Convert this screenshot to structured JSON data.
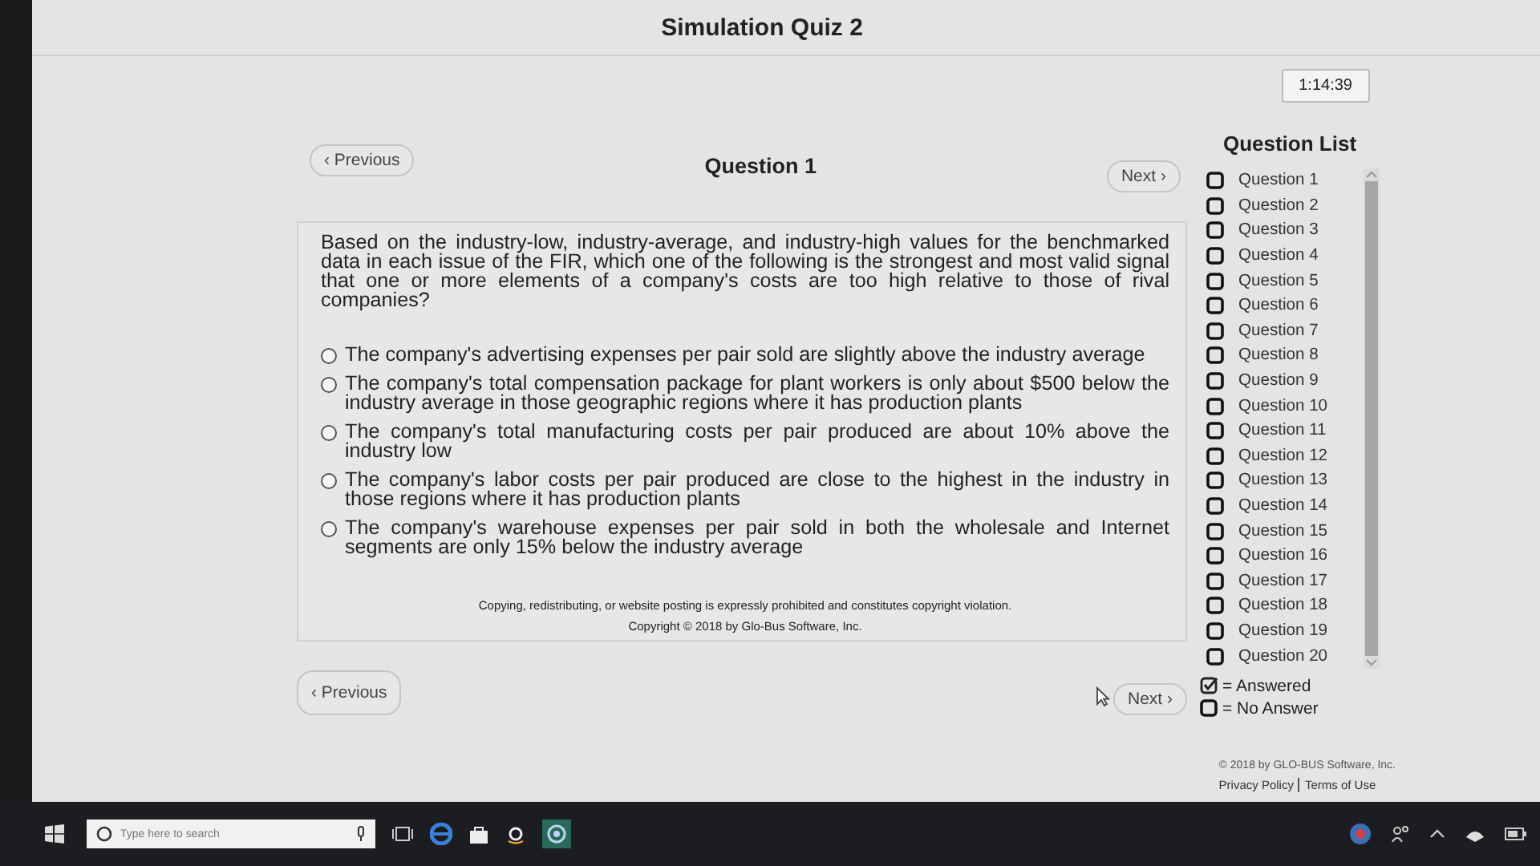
{
  "title": "Simulation Quiz 2",
  "timer": "1:14:39",
  "question": {
    "previous": "‹ Previous",
    "heading": "Question 1",
    "next": "Next ›",
    "text": "Based on the industry-low, industry-average, and industry-high values for the benchmarked data in each issue of the FIR, which one of the following is the strongest and most valid signal that one or more elements of a company's costs are too high relative to those of rival companies?",
    "options": [
      {
        "text": "The company's advertising expenses per pair sold are slightly above the industry average",
        "selected": false
      },
      {
        "text": "The company's total compensation package for plant workers is only about $500 below the industry average in those geographic regions where it has production plants",
        "selected": false
      },
      {
        "text": "The company's total manufacturing costs per pair produced are about 10% above the industry low",
        "selected": false
      },
      {
        "text": "The company's labor costs per pair produced are close to the highest in the industry in those regions where it has production plants",
        "selected": false
      },
      {
        "text": "The company's warehouse expenses per pair sold in both the wholesale and Internet segments are only 15% below the industry average",
        "selected": false
      }
    ],
    "notice": "Copying, redistributing, or website posting is expressly prohibited and constitutes copyright violation.",
    "copyright": "Copyright © 2018 by Glo-Bus Software, Inc."
  },
  "bottom_nav": {
    "previous": "‹ Previous",
    "next": "Next ›"
  },
  "question_list": {
    "title": "Question List",
    "items": [
      {
        "label": "Question 1",
        "answered": false
      },
      {
        "label": "Question 2",
        "answered": false
      },
      {
        "label": "Question 3",
        "answered": false
      },
      {
        "label": "Question 4",
        "answered": false
      },
      {
        "label": "Question 5",
        "answered": false
      },
      {
        "label": "Question 6",
        "answered": false
      },
      {
        "label": "Question 7",
        "answered": false
      },
      {
        "label": "Question 8",
        "answered": false
      },
      {
        "label": "Question 9",
        "answered": false
      },
      {
        "label": "Question 10",
        "answered": false
      },
      {
        "label": "Question 11",
        "answered": false
      },
      {
        "label": "Question 12",
        "answered": false
      },
      {
        "label": "Question 13",
        "answered": false
      },
      {
        "label": "Question 14",
        "answered": false
      },
      {
        "label": "Question 15",
        "answered": false
      },
      {
        "label": "Question 16",
        "answered": false
      },
      {
        "label": "Question 17",
        "answered": false
      },
      {
        "label": "Question 18",
        "answered": false
      },
      {
        "label": "Question 19",
        "answered": false
      },
      {
        "label": "Question 20",
        "answered": false
      }
    ],
    "legend": [
      {
        "kind": "answered",
        "label": "= Answered"
      },
      {
        "kind": "no_answer",
        "label": "= No Answer"
      }
    ]
  },
  "footer": {
    "copyright": "© 2018 by GLO-BUS Software, Inc.",
    "links": [
      "Privacy Policy",
      "Terms of Use"
    ]
  },
  "taskbar": {
    "search_placeholder": "Type here to search"
  }
}
